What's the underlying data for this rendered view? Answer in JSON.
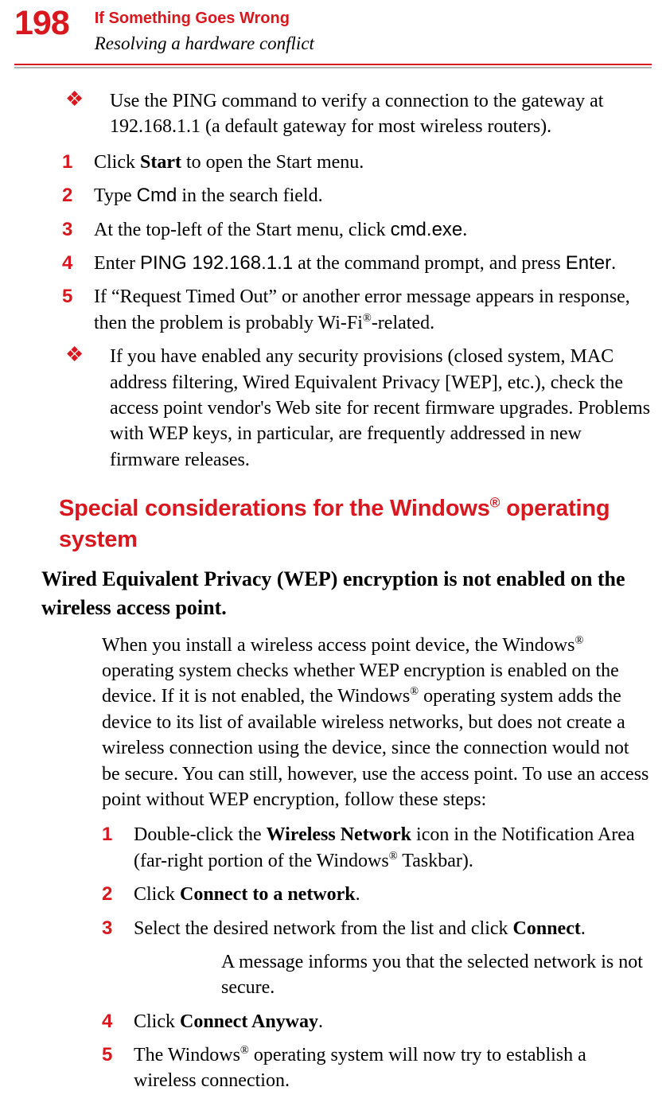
{
  "header": {
    "page_number": "198",
    "chapter_title": "If Something Goes Wrong",
    "chapter_subtitle": "Resolving a hardware conflict"
  },
  "bullets": [
    {
      "text_pre": "Use the PING command to verify a connection to the gateway at 192.168.1.1 (a default gateway for most wireless routers).",
      "steps": [
        {
          "n": "1",
          "html": "Click <b>Start</b> to open the Start menu."
        },
        {
          "n": "2",
          "html": "Type <span class='mono'>Cmd</span> in the search field."
        },
        {
          "n": "3",
          "html": "At the top-left of the Start menu, click <span class='mono'>cmd.exe</span>."
        },
        {
          "n": "4",
          "html": "Enter <span class='mono'>PING 192.168.1.1</span> at the command prompt, and press <span class='mono'>Enter</span>."
        },
        {
          "n": "5",
          "html": "If “Request Timed Out” or another error message appears in response, then the problem is probably Wi-Fi<span class='sup'>®</span>-related."
        }
      ]
    },
    {
      "text_pre": "If you have enabled any security provisions (closed system, MAC address filtering, Wired Equivalent Privacy [WEP], etc.), check the access point vendor's Web site for recent firmware upgrades. Problems with WEP keys, in particular, are frequently addressed in new firmware releases."
    }
  ],
  "section": {
    "heading_html": "Special considerations for the Windows<span class='sup'>®</span> operating system",
    "subheading": "Wired Equivalent Privacy (WEP) encryption is not enabled on the wireless access point.",
    "para_html": "When you install a wireless access point device, the Windows<span class='sup'>®</span> operating system checks whether WEP encryption is enabled on the device. If it is not enabled, the Windows<span class='sup'>®</span> operating system adds the device to its list of available wireless networks, but does not create a wireless connection using the device, since the connection would not be secure. You can still, however, use the access point. To use an access point without WEP encryption, follow these steps:",
    "steps": [
      {
        "n": "1",
        "html": "Double-click the <b>Wireless Network</b> icon in the Notification Area (far-right portion of the Windows<span class='sup'>®</span> Taskbar)."
      },
      {
        "n": "2",
        "html": "Click <b>Connect to a network</b>."
      },
      {
        "n": "3",
        "html": "Select the desired network from the list and click <b>Connect</b>.",
        "after": "A message informs you that the selected network is not secure."
      },
      {
        "n": "4",
        "html": "Click <b>Connect Anyway</b>."
      },
      {
        "n": "5",
        "html": "The Windows<span class='sup'>®</span> operating system will now try to establish a wireless connection."
      }
    ]
  }
}
